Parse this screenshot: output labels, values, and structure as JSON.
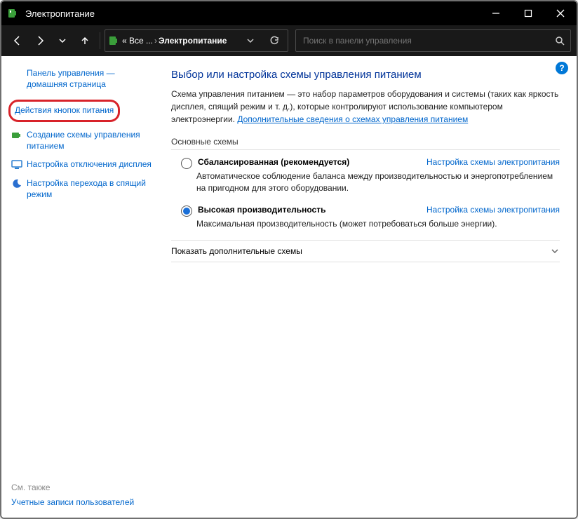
{
  "window": {
    "title": "Электропитание"
  },
  "nav": {
    "back": "←",
    "forward": "→",
    "recent": "⌄",
    "up": "↑",
    "crumb_prefix": "« Все ...",
    "crumb_current": "Электропитание",
    "search_placeholder": "Поиск в панели управления"
  },
  "sidebar": {
    "home": "Панель управления — домашняя страница",
    "highlighted": "Действия кнопок питания",
    "items": [
      "Создание схемы управления питанием",
      "Настройка отключения дисплея",
      "Настройка перехода в спящий режим"
    ],
    "see_also_label": "См. также",
    "see_also_link": "Учетные записи пользователей"
  },
  "main": {
    "heading": "Выбор или настройка схемы управления питанием",
    "intro_text": "Схема управления питанием — это набор параметров оборудования и системы (таких как яркость дисплея, спящий режим и т. д.), которые контролируют использование компьютером электроэнергии. ",
    "intro_link": "Дополнительные сведения о схемах управления питанием",
    "section": "Основные схемы",
    "plans": [
      {
        "name": "Сбалансированная (рекомендуется)",
        "desc": "Автоматическое соблюдение баланса между производительностью и энергопотреблением на пригодном для этого оборудовании.",
        "cfg": "Настройка схемы электропитания",
        "checked": false
      },
      {
        "name": "Высокая производительность",
        "desc": "Максимальная производительность (может потребоваться больше энергии).",
        "cfg": "Настройка схемы электропитания",
        "checked": true
      }
    ],
    "expand": "Показать дополнительные схемы"
  }
}
